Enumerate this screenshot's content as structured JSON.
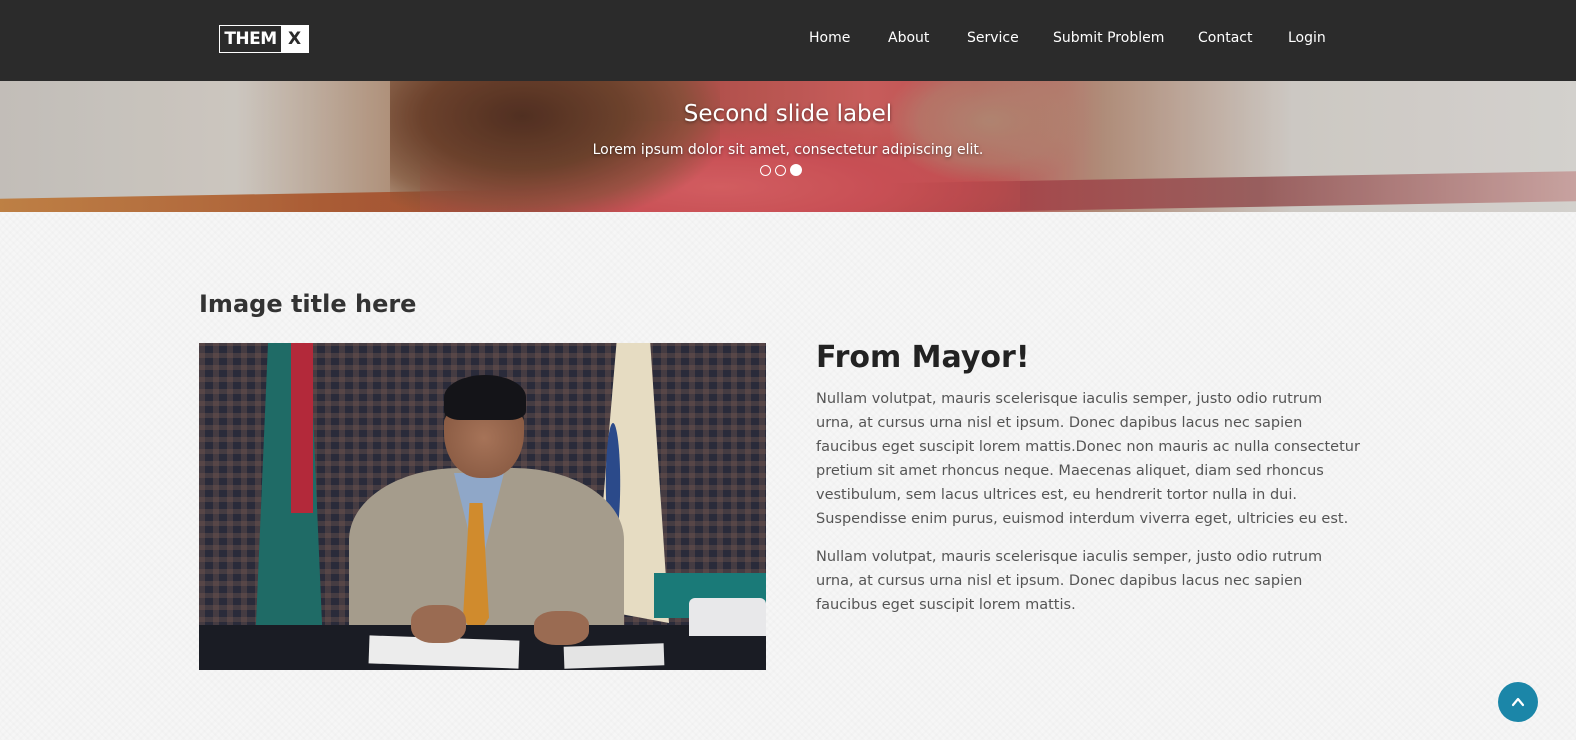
{
  "navbar": {
    "logo_left": "THEM",
    "logo_right": "X",
    "links": [
      "Home",
      "About",
      "Service",
      "Submit Problem",
      "Contact",
      "Login"
    ]
  },
  "hero": {
    "label": "Second slide label",
    "text": "Lorem ipsum dolor sit amet, consectetur adipiscing elit.",
    "active_slide_index": 2,
    "slide_count": 3
  },
  "content": {
    "image_title": "Image title here",
    "heading": "From Mayor!",
    "paragraph_1": "Nullam volutpat, mauris scelerisque iaculis semper, justo odio rutrum urna, at cursus urna nisl et ipsum. Donec dapibus lacus nec sapien faucibus eget suscipit lorem mattis.Donec non mauris ac nulla consectetur pretium sit amet rhoncus neque. Maecenas aliquet, diam sed rhoncus vestibulum, sem lacus ultrices est, eu hendrerit tortor nulla in dui. Suspendisse enim purus, euismod interdum viverra eget, ultricies eu est.",
    "paragraph_2": "Nullam volutpat, mauris scelerisque iaculis semper, justo odio rutrum urna, at cursus urna nisl et ipsum. Donec dapibus lacus nec sapien faucibus eget suscipit lorem mattis."
  },
  "colors": {
    "navbar_bg": "#2b2b2b",
    "back_to_top": "#1b86a8"
  },
  "icons": {
    "back_to_top": "chevron-up-icon"
  }
}
